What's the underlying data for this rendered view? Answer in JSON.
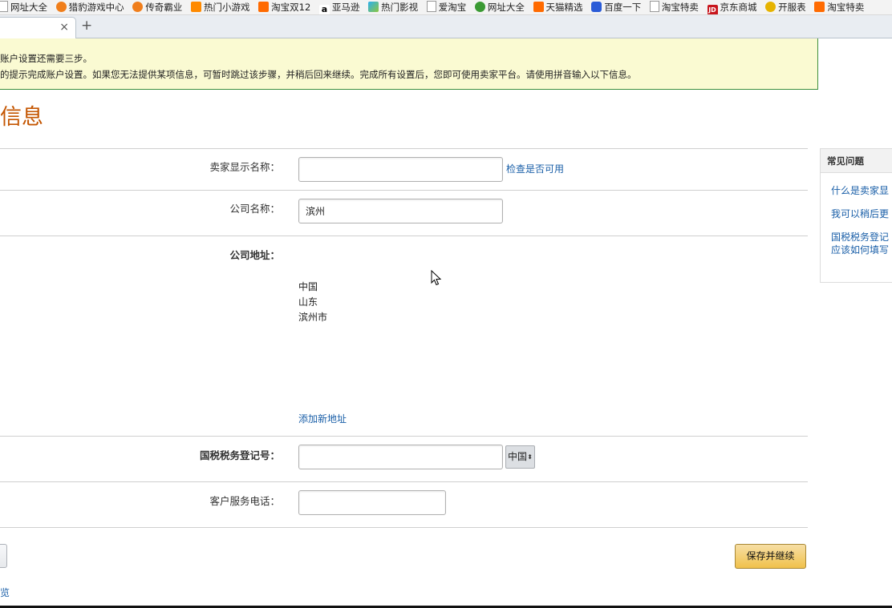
{
  "bookmarks": [
    {
      "label": "网址大全",
      "icon": "page-icon"
    },
    {
      "label": "猎豹游戏中心",
      "icon": "game-icon"
    },
    {
      "label": "传奇霸业",
      "icon": "game-icon"
    },
    {
      "label": "热门小游戏",
      "icon": "game-icon"
    },
    {
      "label": "淘宝双12",
      "icon": "taobao-icon"
    },
    {
      "label": "亚马逊",
      "icon": "amazon-icon"
    },
    {
      "label": "热门影视",
      "icon": "video-icon"
    },
    {
      "label": "爱淘宝",
      "icon": "page-icon"
    },
    {
      "label": "网址大全",
      "icon": "globe-icon"
    },
    {
      "label": "天猫精选",
      "icon": "taobao-icon"
    },
    {
      "label": "百度一下",
      "icon": "baidu-paw-icon"
    },
    {
      "label": "淘宝特卖",
      "icon": "page-icon"
    },
    {
      "label": "京东商城",
      "icon": "jd-icon"
    },
    {
      "label": "开服表",
      "icon": "game-icon"
    },
    {
      "label": "淘宝特卖",
      "icon": "taobao-icon"
    }
  ],
  "tabs": {
    "close_glyph": "×",
    "new_tab_glyph": "+"
  },
  "notice": {
    "line1": "账户设置还需要三步。",
    "line2": "的提示完成账户设置。如果您无法提供某项信息，可暂时跳过该步骤，并稍后回来继续。完成所有设置后，您即可使用卖家平台。请使用拼音输入以下信息。"
  },
  "page_title": "信息",
  "form": {
    "seller_name": {
      "label": "卖家显示名称：",
      "value": "",
      "check_link": "检查是否可用"
    },
    "company_name": {
      "label": "公司名称：",
      "value": "滨州"
    },
    "company_address": {
      "label": "公司地址：",
      "lines": [
        "中国",
        "山东",
        "滨州市"
      ],
      "add_link": "添加新地址"
    },
    "tax_id": {
      "label": "国税税务登记号：",
      "value": "",
      "country": "中国",
      "country_arrow": "⬍"
    },
    "phone": {
      "label": "客户服务电话：",
      "value": ""
    }
  },
  "actions": {
    "save_label": "保存并继续",
    "bottom_link": "览"
  },
  "faq": {
    "title": "常见问题",
    "items": [
      "什么是卖家显",
      "我可以稍后更",
      "国税税务登记",
      "应该如何填写"
    ]
  },
  "colors": {
    "title_orange": "#c45500",
    "link_blue": "#1a5fa8",
    "notice_bg": "#fafad2",
    "notice_border": "#3d8f3d",
    "save_button": "#f0c14b"
  }
}
